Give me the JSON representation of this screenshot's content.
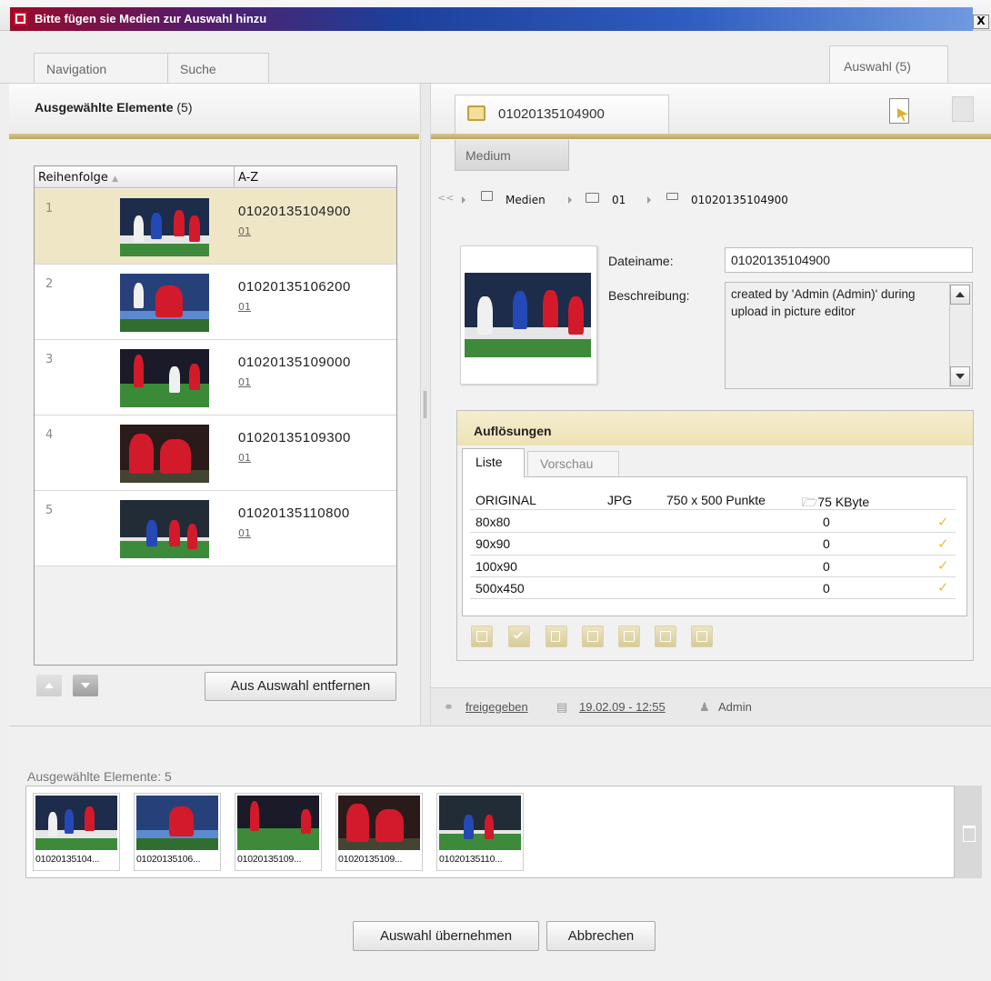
{
  "window": {
    "title": "Bitte fügen sie Medien zur Auswahl hinzu",
    "close": "X"
  },
  "tabs": {
    "navigation": "Navigation",
    "suche": "Suche",
    "auswahl": "Auswahl (5)"
  },
  "left": {
    "header_title": "Ausgewählte Elemente",
    "header_count": "(5)",
    "columns": {
      "order": "Reihenfolge",
      "az": "A-Z"
    },
    "rows": [
      {
        "num": "1",
        "name": "01020135104900",
        "folder": "01"
      },
      {
        "num": "2",
        "name": "01020135106200",
        "folder": "01"
      },
      {
        "num": "3",
        "name": "01020135109000",
        "folder": "01"
      },
      {
        "num": "4",
        "name": "01020135109300",
        "folder": "01"
      },
      {
        "num": "5",
        "name": "01020135110800",
        "folder": "01"
      }
    ],
    "remove_button": "Aus Auswahl entfernen"
  },
  "right": {
    "media_tab": "01020135104900",
    "subtab": "Medium",
    "breadcrumb": {
      "back": "<<",
      "root": "Medien",
      "folder": "01",
      "item": "01020135104900"
    },
    "fields": {
      "filename_label": "Dateiname:",
      "filename_value": "01020135104900",
      "description_label": "Beschreibung:",
      "description_value": "created by 'Admin (Admin)' during upload in picture editor"
    },
    "resolutions": {
      "title": "Auflösungen",
      "tabs": {
        "list": "Liste",
        "preview": "Vorschau"
      },
      "original": {
        "name": "ORIGINAL",
        "format": "JPG",
        "dims": "750 x 500 Punkte",
        "size": "75 KByte"
      },
      "rows": [
        {
          "name": "80x80",
          "value": "0",
          "check": "✓"
        },
        {
          "name": "90x90",
          "value": "0",
          "check": "✓"
        },
        {
          "name": "100x90",
          "value": "0",
          "check": "✓"
        },
        {
          "name": "500x450",
          "value": "0",
          "check": "✓"
        }
      ]
    },
    "status": {
      "state": "freigegeben",
      "date": "19.02.09 - 12:55",
      "user": "Admin"
    }
  },
  "bottom": {
    "selected_label": "Ausgewählte Elemente: 5",
    "thumbs": [
      "01020135104...",
      "01020135106...",
      "01020135109...",
      "01020135109...",
      "01020135110..."
    ],
    "ok_button": "Auswahl übernehmen",
    "cancel_button": "Abbrechen"
  },
  "colors": {
    "accent": "#d9c57a",
    "selected_row": "#efe6c6",
    "title_gradient": "#2e5cc0"
  },
  "icons": [
    "app-logo-icon",
    "close-icon",
    "media-icon",
    "export-icon",
    "copy-icon",
    "folder-icon",
    "status-icon",
    "calendar-icon",
    "user-icon",
    "trash-icon",
    "arrow-up-icon",
    "arrow-down-icon",
    "check-icon"
  ]
}
